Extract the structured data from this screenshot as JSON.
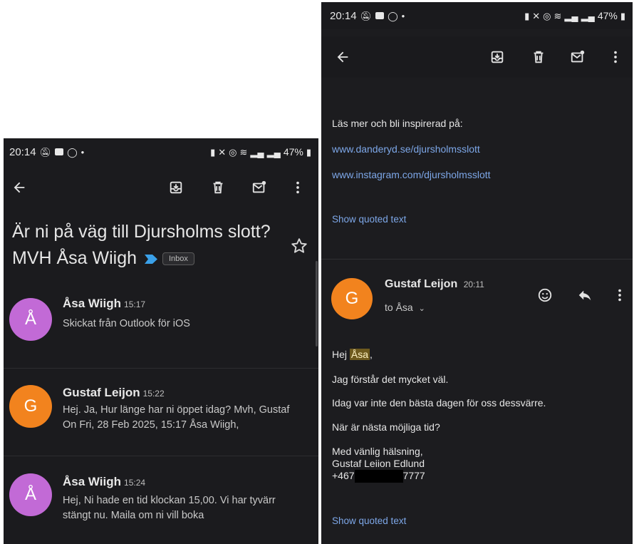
{
  "status_bar": {
    "time": "20:14",
    "battery": "47%"
  },
  "left": {
    "subject": "Är ni på väg till Djursholms slott? MVH Åsa Wiigh",
    "label": "Inbox",
    "messages": [
      {
        "initial": "Å",
        "sender": "Åsa Wiigh",
        "time": "15:17",
        "snippet": "Skickat från Outlook för iOS",
        "avatar_color": "#c26ad6"
      },
      {
        "initial": "G",
        "sender": "Gustaf Leijon",
        "time": "15:22",
        "snippet": "Hej. Ja, Hur länge har ni öppet idag? Mvh, Gustaf On Fri, 28 Feb 2025, 15:17 Åsa Wiigh,",
        "avatar_color": "#f2831e"
      },
      {
        "initial": "Å",
        "sender": "Åsa Wiigh",
        "time": "15:24",
        "snippet": "Hej, Ni hade en tid klockan 15,00. Vi har tyvärr stängt nu. Maila om ni vill boka",
        "avatar_color": "#c26ad6"
      }
    ]
  },
  "right": {
    "inspire_text": "Läs mer och bli inspirerad på:",
    "link1": "www.danderyd.se/djursholmsslott",
    "link2": "www.instagram.com/djursholmsslott",
    "show_quoted_1": "Show quoted text",
    "sender": {
      "initial": "G",
      "name": "Gustaf Leijon",
      "time": "20:11",
      "to": "to Åsa",
      "avatar_color": "#f2831e"
    },
    "body": {
      "greeting_prefix": "Hej",
      "greeting_name": "Åsa",
      "greeting_suffix": ",",
      "line1": "Jag förstår det mycket väl.",
      "line2": "Idag var inte den bästa dagen för oss dessvärre.",
      "line3": "När är nästa möjliga tid?",
      "sig1": "Med vänlig hälsning,",
      "sig2": "Gustaf Leiion Edlund",
      "phone_prefix": "+467",
      "phone_suffix": "7777"
    },
    "show_quoted_2": "Show quoted text"
  }
}
